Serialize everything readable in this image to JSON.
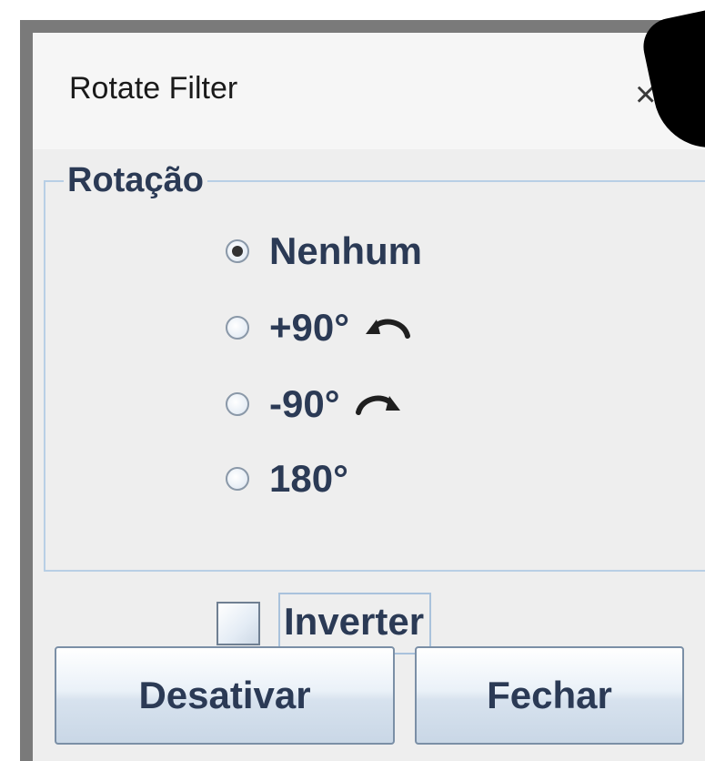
{
  "dialog": {
    "title": "Rotate Filter",
    "close_symbol": "×"
  },
  "rotation_group": {
    "legend": "Rotação",
    "options": [
      {
        "label": "Nenhum",
        "selected": true
      },
      {
        "label": "+90°",
        "selected": false,
        "icon": "rotate-counterclockwise-icon"
      },
      {
        "label": "-90°",
        "selected": false,
        "icon": "rotate-clockwise-icon"
      },
      {
        "label": "180°",
        "selected": false
      }
    ]
  },
  "invert": {
    "label": "Inverter",
    "checked": false
  },
  "buttons": {
    "disable_label": "Desativar",
    "close_label": "Fechar"
  },
  "colors": {
    "text": "#2b3a55",
    "group_border": "#b8cfe5",
    "window_bg": "#eeeeee"
  }
}
